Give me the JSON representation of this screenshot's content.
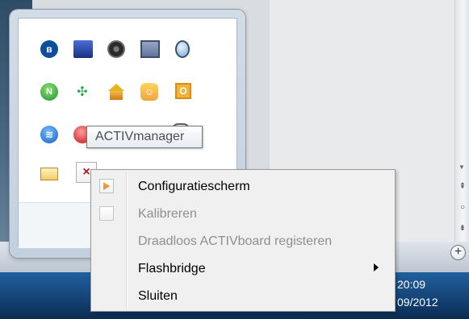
{
  "tooltip": {
    "text": "ACTIVmanager"
  },
  "context_menu": {
    "items": [
      {
        "label": "Configuratiescherm",
        "enabled": true,
        "icon": "configuratiescherm-icon"
      },
      {
        "label": "Kalibreren",
        "enabled": false,
        "icon": "kalibreren-icon"
      },
      {
        "label": "Draadloos ACTIVboard registeren",
        "enabled": false
      },
      {
        "label": "Flashbridge",
        "enabled": true,
        "submenu": true
      },
      {
        "label": "Sluiten",
        "enabled": true
      }
    ]
  },
  "taskbar": {
    "time": "20:09",
    "date": "09/2012"
  },
  "tray_icons": [
    "bluetooth-icon",
    "monitor-icon",
    "speaker-icon",
    "laptop-icon",
    "bulb-icon",
    "green-app-icon",
    "network-icon",
    "home-icon",
    "chat-icon",
    "orange-app-icon",
    "blue-app-icon",
    "red-app-icon",
    "cloud-icon",
    "mail-icon",
    "activmanager-icon"
  ],
  "colors": {
    "taskbar": "#123f70",
    "menu_background": "#f0f0f0",
    "disabled_text": "#8f8f8f"
  }
}
